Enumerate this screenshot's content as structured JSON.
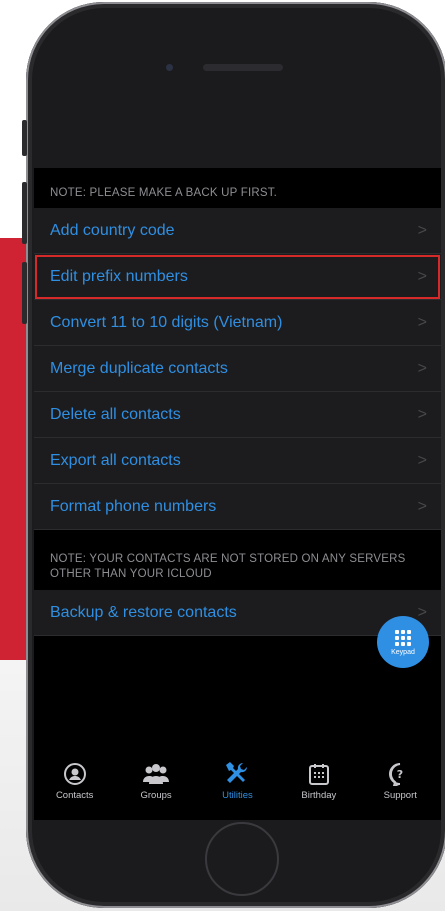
{
  "notes": {
    "top": "NOTE: PLEASE MAKE A BACK UP FIRST.",
    "middle": "NOTE: YOUR CONTACTS ARE NOT STORED ON ANY SERVERS OTHER THAN YOUR ICLOUD"
  },
  "utilities": {
    "items": [
      {
        "label": "Add country code"
      },
      {
        "label": "Edit prefix numbers"
      },
      {
        "label": "Convert 11 to 10 digits (Vietnam)"
      },
      {
        "label": "Merge duplicate contacts"
      },
      {
        "label": "Delete all contacts"
      },
      {
        "label": "Export all contacts"
      },
      {
        "label": "Format phone numbers"
      }
    ],
    "backup": {
      "label": "Backup & restore contacts"
    }
  },
  "fab": {
    "label": "Keypad",
    "icon": "keypad-grid-icon"
  },
  "tabs": [
    {
      "label": "Contacts",
      "icon": "person-circle-icon"
    },
    {
      "label": "Groups",
      "icon": "group-icon"
    },
    {
      "label": "Utilities",
      "icon": "tools-icon",
      "active": true
    },
    {
      "label": "Birthday",
      "icon": "calendar-icon"
    },
    {
      "label": "Support",
      "icon": "question-bubble-icon"
    }
  ],
  "colors": {
    "accent": "#2f8fe3",
    "highlight": "#d62a2a",
    "brand_band": "#cf2232",
    "row_bg": "#1c1c1e",
    "screen_bg": "#000000"
  }
}
